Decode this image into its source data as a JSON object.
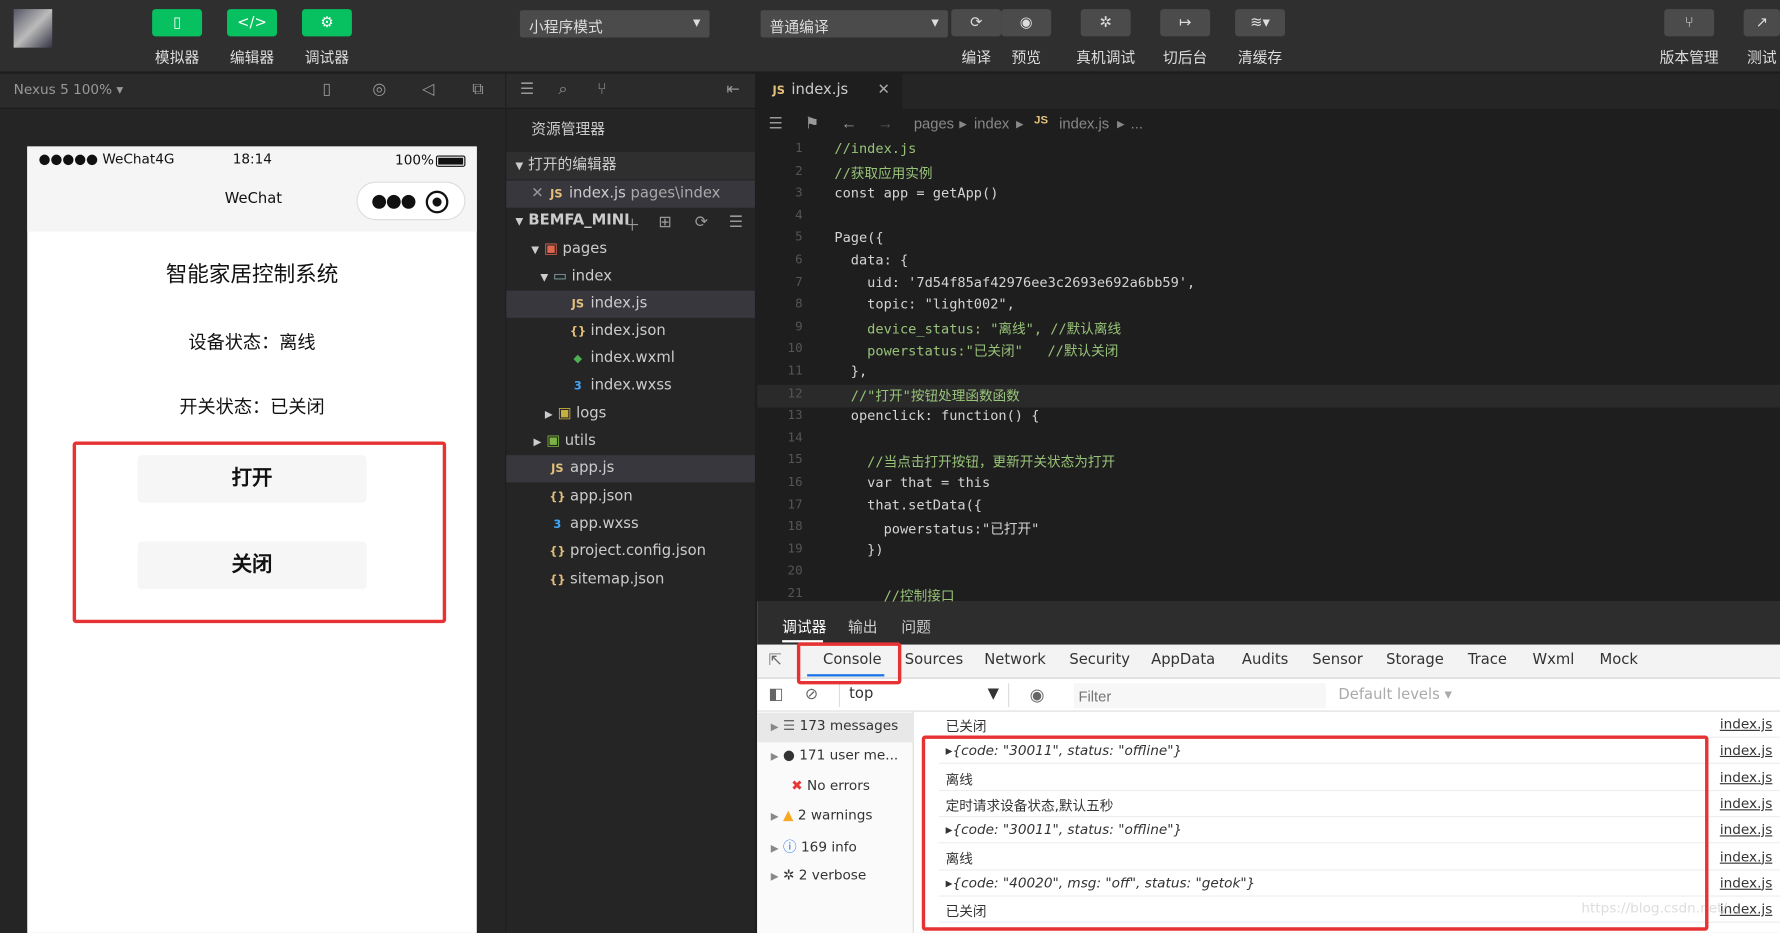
{
  "toolbar": {
    "simulator": "模拟器",
    "editor": "编辑器",
    "debugger": "调试器",
    "mode": "小程序模式",
    "compile_mode": "普通编译",
    "compile": "编译",
    "preview": "预览",
    "real_debug": "真机调试",
    "background": "切后台",
    "clear_cache": "清缓存",
    "version": "版本管理",
    "test": "测试"
  },
  "device": "Nexus 5 100%",
  "phone": {
    "carrier": "●●●●● WeChat4G",
    "time": "18:14",
    "battery": "100%",
    "nav_title": "WeChat",
    "page_title": "智能家居控制系统",
    "device_status": "设备状态：离线",
    "switch_status": "开关状态：已关闭",
    "open_btn": "打开",
    "close_btn": "关闭"
  },
  "explorer": {
    "title": "资源管理器",
    "open_editors": "打开的编辑器",
    "open_file": "index.js",
    "open_file_path": "pages\\index",
    "project": "BEMFA_MINI",
    "items": [
      {
        "label": "pages",
        "indent": 1
      },
      {
        "label": "index",
        "indent": 2
      },
      {
        "label": "index.js",
        "indent": 3
      },
      {
        "label": "index.json",
        "indent": 3
      },
      {
        "label": "index.wxml",
        "indent": 3
      },
      {
        "label": "index.wxss",
        "indent": 3
      },
      {
        "label": "logs",
        "indent": 2
      },
      {
        "label": "utils",
        "indent": 1
      },
      {
        "label": "app.js",
        "indent": 1
      },
      {
        "label": "app.json",
        "indent": 1
      },
      {
        "label": "app.wxss",
        "indent": 1
      },
      {
        "label": "project.config.json",
        "indent": 1
      },
      {
        "label": "sitemap.json",
        "indent": 1
      }
    ]
  },
  "editor": {
    "tab": "index.js",
    "breadcrumb": [
      "pages",
      "index",
      "index.js",
      "..."
    ],
    "lines": [
      "//index.js",
      "//获取应用实例",
      "const app = getApp()",
      "",
      "Page({",
      "  data: {",
      "    uid: '7d54f85af42976ee3c2693e692a6bb59',",
      "    topic: \"light002\",",
      "    device_status: \"离线\", //默认离线",
      "    powerstatus:\"已关闭\"   //默认关闭",
      "  },",
      "  //\"打开\"按钮处理函数函数",
      "  openclick: function() {",
      "",
      "    //当点击打开按钮，更新开关状态为打开",
      "    var that = this",
      "    that.setData({",
      "      powerstatus:\"已打开\"",
      "    })",
      "",
      "      //控制接口"
    ]
  },
  "devtools": {
    "top_tabs": [
      "调试器",
      "输出",
      "问题"
    ],
    "tabs": [
      "Console",
      "Sources",
      "Network",
      "Security",
      "AppData",
      "Audits",
      "Sensor",
      "Storage",
      "Trace",
      "Wxml",
      "Mock"
    ],
    "context": "top",
    "filter_placeholder": "Filter",
    "levels": "Default levels",
    "sidebar": [
      "173 messages",
      "171 user me...",
      "No errors",
      "2 warnings",
      "169 info",
      "2 verbose"
    ],
    "messages": [
      "已关闭",
      "{code: \"30011\", status: \"offline\"}",
      "离线",
      "定时请求设备状态,默认五秒",
      "{code: \"30011\", status: \"offline\"}",
      "离线",
      "{code: \"40020\", msg: \"off\", status: \"getok\"}",
      "已关闭"
    ],
    "source": "index.js",
    "watermark": "https://blog.csdn.net/..."
  }
}
